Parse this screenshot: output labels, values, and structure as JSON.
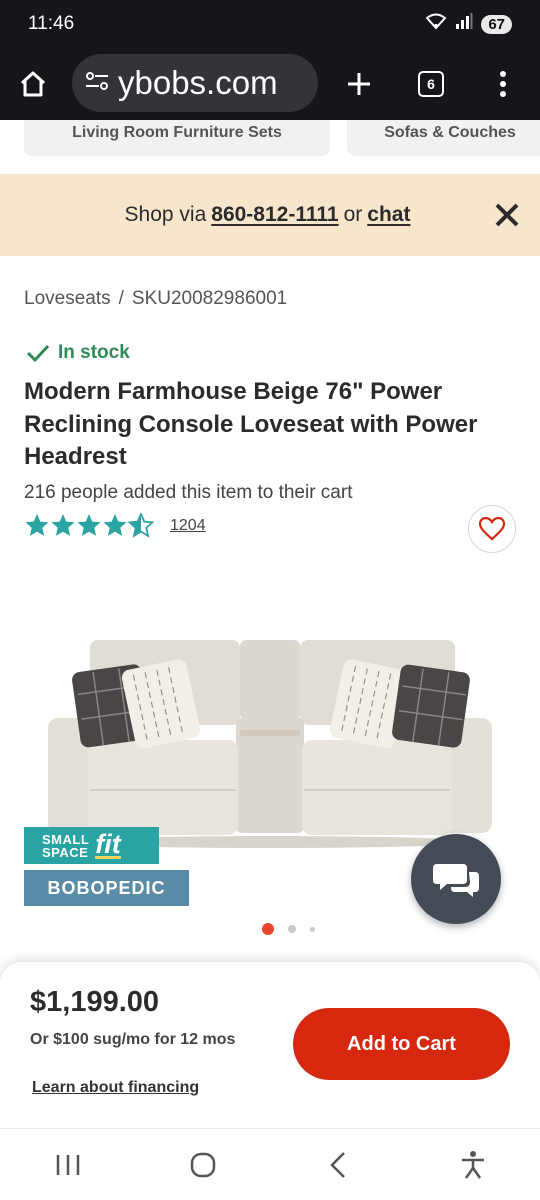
{
  "status_bar": {
    "time": "11:46",
    "battery": "67",
    "wifi_label": "6"
  },
  "browser": {
    "url": "ybobs.com",
    "tab_count": "6"
  },
  "categories": [
    {
      "label": "Living Room Furniture Sets"
    },
    {
      "label": "Sofas & Couches"
    }
  ],
  "banner": {
    "prefix": "Shop via",
    "phone": "860-812-1111",
    "connector": "or",
    "chat": "chat"
  },
  "breadcrumb": {
    "category": "Loveseats",
    "separator": "/",
    "sku": "SKU20082986001"
  },
  "product": {
    "stock": "In stock",
    "title": "Modern Farmhouse Beige 76\" Power Reclining Console Loveseat with Power Headrest",
    "carted": "216 people added this item to their cart",
    "rating": 4.5,
    "review_count": "1204",
    "badges": {
      "small": "SMALL",
      "space": "SPACE",
      "fit": "fit",
      "bobopedic": "BOBOPEDIC"
    }
  },
  "carousel": {
    "active_index": 0,
    "count": 3
  },
  "purchase": {
    "price": "$1,199.00",
    "monthly": "Or $100 sug/mo for 12 mos",
    "financing_link": "Learn about financing",
    "add_to_cart": "Add to Cart"
  },
  "colors": {
    "accent": "#d6280f",
    "stock": "#2e8b57",
    "stars": "#2aa3a3",
    "banner": "#f8e6cc"
  }
}
